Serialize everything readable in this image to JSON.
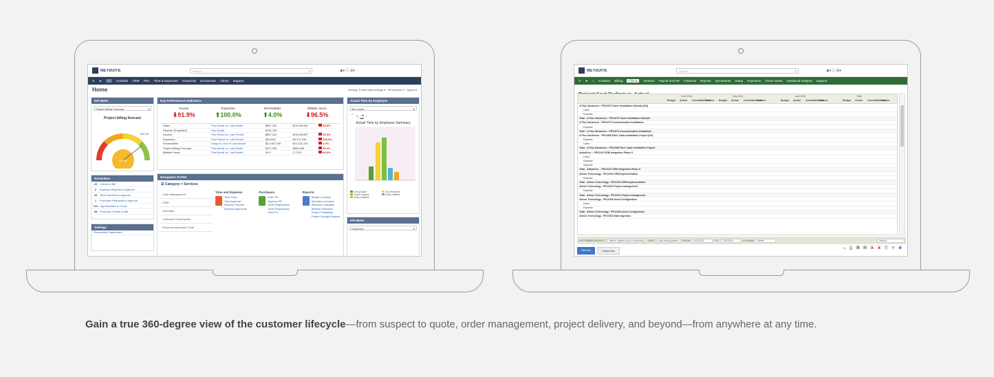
{
  "caption": {
    "bold": "Gain a true 360-degree view of the customer lifecycle",
    "rest": "—from suspect to quote, order management, project delivery, and beyond—from anywhere at any time."
  },
  "left": {
    "logo": "NETSUITE",
    "search_placeholder": "Search",
    "nav": [
      "Activities",
      "CRM",
      "PSA",
      "Time & Expenses",
      "Financials",
      "Documents",
      "Admin",
      "Support"
    ],
    "page_title": "Home",
    "header_right": [
      "Viewing: Portlet data settings ▾",
      "Personalize ▾",
      "Layout ▾"
    ],
    "kpi_meter": {
      "title": "KPI Meter",
      "select": "Project Billing Forecast",
      "gauge_title": "Project billing forecast",
      "gauge_max": "200.0K",
      "gauge_value": "157.5K",
      "gauge_fraction": 0.79
    },
    "kpi": {
      "title": "Key Performance Indicators",
      "cols": [
        "Income",
        "Expenses",
        "Receivables",
        "Billable Hours"
      ],
      "values": [
        "91.9%",
        "100.0%",
        "4.0%",
        "96.5%"
      ],
      "directions": [
        "down",
        "up",
        "up",
        "down"
      ],
      "rows": [
        {
          "label": "Sales",
          "period": "This Month vs. Last Month",
          "cur": "$657,161",
          "prev": "$13,049.951",
          "pct": "95.9%"
        },
        {
          "label": "Pipeline (Projected)",
          "period": "This Month",
          "cur": "$762,753",
          "prev": "",
          "pct": ""
        },
        {
          "label": "Income",
          "period": "This Period vs. Last Period",
          "cur": "$657,161",
          "prev": "$15,035.897",
          "pct": "91.9%"
        },
        {
          "label": "Expenses",
          "period": "This Period vs. Last Period",
          "cur": "($3,815)",
          "prev": "$3,471,946",
          "pct": "100.0%"
        },
        {
          "label": "Receivables",
          "period": "Today vs. End of Last Month",
          "cur": "$21,067,299",
          "prev": "$21,422,202",
          "pct": "4.0%"
        },
        {
          "label": "Project Billing Forecast",
          "period": "This Month vs. Last Month",
          "cur": "$117,355",
          "prev": "$663,366",
          "pct": "96.4%"
        },
        {
          "label": "Billable Hours",
          "period": "This Month vs. Last Month",
          "cur": "94.0",
          "prev": "2,733.0",
          "pct": "96.5%"
        }
      ]
    },
    "actual_time": {
      "title": "Actual Time by Employee",
      "select": "this month",
      "chart_title": "Actual Time by Employee Summary"
    },
    "reminders": {
      "title": "Reminders",
      "items": [
        {
          "n": "25",
          "t": "Clients in Bill"
        },
        {
          "n": "6",
          "t": "Expense Reports to Approve"
        },
        {
          "n": "20",
          "t": "Time Records to Approve"
        },
        {
          "n": "1",
          "t": "Purchase Requests to Approve"
        },
        {
          "n": "124",
          "t": "Opportunities to Close"
        },
        {
          "n": "38",
          "t": "Purchase Orders to Bill"
        }
      ]
    },
    "settings": {
      "title": "Settings",
      "items": [
        "Personalize Dashboard"
      ]
    },
    "nav_portlet": {
      "title": "Navigation Portlet",
      "crumb": "Category > Services",
      "menu": [
        "Cash Management",
        "CRM",
        "Overrides",
        "Controller Fixed Assets",
        "Resource Allocation Chart"
      ],
      "time_exp": {
        "head": "Time and Expense",
        "items": [
          "Time Entry",
          "Time Approval",
          "Expense Reports",
          "Expense Approvals"
        ]
      },
      "purchases": {
        "head": "Purchases",
        "items": [
          "Enter PR",
          "Approve PR",
          "Order Requisitions",
          "Order Requisitions",
          "View P.O."
        ]
      },
      "reports": {
        "head": "Reports",
        "items": [
          "Budget vs Actual",
          "Allocation vs Actual",
          "Resource Utilization",
          "Website Utilization",
          "Project Profitability",
          "Project Change Request"
        ]
      }
    },
    "kpi_meter2": {
      "title": "KPI Meter",
      "select": "Expenses"
    },
    "legend": [
      "Corey Baker",
      "Tina Holsome",
      "Jamie Hughes",
      "Oliver Walters",
      "Jesse Heyman"
    ]
  },
  "right": {
    "logo": "NETSUITE",
    "search_placeholder": "Search",
    "nav": [
      "Activities",
      "Billing",
      "Clients",
      "Vendors",
      "Payroll and HR",
      "Financial",
      "Reports",
      "Documents",
      "Setup",
      "Payments",
      "Fixed Assets",
      "Statistical Analysis",
      "Support"
    ],
    "page_title": "Project Cost Budget vs. Actual",
    "subtitle": "Export Report | Customize",
    "col_groups": [
      "June 2016",
      "July 2016",
      "June 2016",
      "Total"
    ],
    "col_sub": [
      "Budget",
      "Actual",
      "Committed Cost",
      "Variance"
    ],
    "rows": [
      "A Plus Gardeners : PRJ1079 Tower Installation Network (Ed)",
      "Labor",
      "Expense",
      "Total - A Plus Gardeners : PRJ1079 Tower Installation Network",
      "A Plus Gardeners : PRJ1075 Communication Installation",
      "Expense",
      "Total - A Plus Gardeners : PRJ1075 Communication Installation",
      "A Plus Gardeners : PRJ1068 Fiber Cable Installation Project (Ed)",
      "Expense",
      "Labor",
      "Total - A Plus Gardeners : PRJ1068 Fiber Cable Installation Project",
      "Abbott Inc. : PRJ1130 CRM Integration Phase II",
      "Labor",
      "Expense",
      "Supplies",
      "Total - Abbott Inc. : PRJ1130 CRM Integration Phase II",
      "Alimex Technology : PRJ1016 CRM Implementation",
      "Expense",
      "Total - Alimex Technology : PRJ1016 CRM Implementation",
      "Alimex Technology : PRJ1012 Project management",
      "Expense",
      "Total - Alimex Technology : PRJ1012 Project management",
      "Alimex Technology : PRJ1005 Asset Configuration",
      "Labor",
      "Expense",
      "Total - Alimex Technology : PRJ1005 Asset Configuration",
      "Alimex Technology : PRJ1002 Data migration"
    ],
    "filter": {
      "label1": "CUSTOMER:PROJECT",
      "value1": "Alimex System (ALL/Continued)",
      "label2": "DATE",
      "value2": "last rolling quarter",
      "label3": "FROM",
      "value3": "6/1/2016",
      "label4": "TO",
      "value4": "7/31/2016",
      "label5": "COLUMN",
      "value5": "Month",
      "search": "Search"
    },
    "buttons": [
      "Refresh",
      "Customize"
    ]
  },
  "colors": {
    "navy": "#2e3e5c",
    "green": "#2f6b35",
    "red": "#d21f1f",
    "kpi_green": "#3a8e1a",
    "blue_head": "#5b6f8f"
  }
}
